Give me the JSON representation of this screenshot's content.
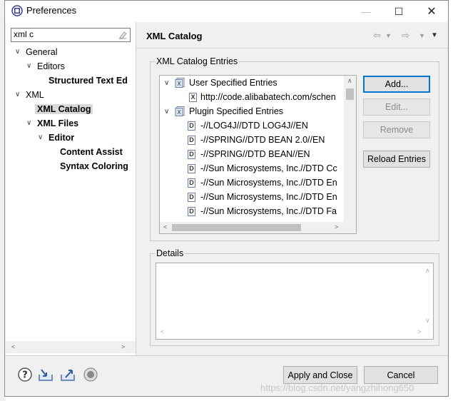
{
  "window": {
    "title": "Preferences"
  },
  "filter": {
    "value": "xml c"
  },
  "tree": {
    "general": "General",
    "editors": "Editors",
    "structured_text": "Structured Text Ed",
    "xml": "XML",
    "xml_catalog": "XML Catalog",
    "xml_files": "XML Files",
    "editor": "Editor",
    "content_assist": "Content Assist",
    "syntax_coloring": "Syntax Coloring"
  },
  "page": {
    "title": "XML Catalog"
  },
  "entries_group": {
    "label": "XML Catalog Entries",
    "user_specified": "User Specified Entries",
    "user_entry": "http://code.alibabatech.com/schen",
    "plugin_specified": "Plugin Specified Entries",
    "plugin_entries": [
      "-//LOG4J//DTD LOG4J//EN",
      "-//SPRING//DTD BEAN 2.0//EN",
      "-//SPRING//DTD BEAN//EN",
      "-//Sun Microsystems, Inc.//DTD Cc",
      "-//Sun Microsystems, Inc.//DTD En",
      "-//Sun Microsystems, Inc.//DTD En",
      "-//Sun Microsystems, Inc.//DTD Fa"
    ]
  },
  "buttons": {
    "add": "Add...",
    "edit": "Edit...",
    "remove": "Remove",
    "reload": "Reload Entries",
    "apply_close": "Apply and Close",
    "cancel": "Cancel"
  },
  "details": {
    "label": "Details"
  },
  "watermark": "https://blog.csdn.net/yangzhihong650"
}
